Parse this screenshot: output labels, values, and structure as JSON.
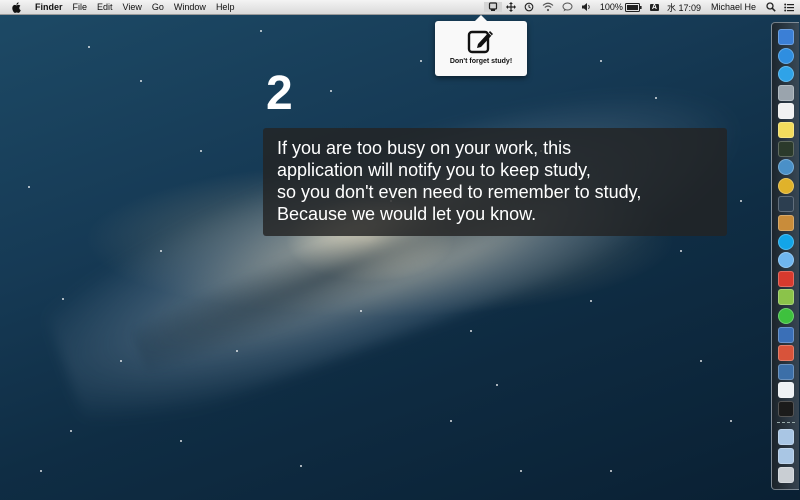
{
  "menubar": {
    "app_name": "Finder",
    "menus": [
      "File",
      "Edit",
      "View",
      "Go",
      "Window",
      "Help"
    ],
    "battery": "100%",
    "input_source": "A",
    "clock": "水 17:09",
    "user_name": "Michael He"
  },
  "popover": {
    "caption": "Don't forget study!"
  },
  "overlay": {
    "step_number": "2",
    "lines": [
      "If you are too busy on your work, this",
      "application will notify you to keep study,",
      "so you don't even need to remember to study,",
      "Because we would let you know."
    ]
  },
  "dock": {
    "items": [
      {
        "icon": "finder-icon",
        "color": "#3b7fd6"
      },
      {
        "icon": "app-store-icon",
        "color": "#2f8ee0"
      },
      {
        "icon": "itunes-icon",
        "color": "#2fa3e8"
      },
      {
        "icon": "photo-icon",
        "color": "#9aa4ad"
      },
      {
        "icon": "textedit-icon",
        "color": "#f1f1f1"
      },
      {
        "icon": "stickies-icon",
        "color": "#f2dc5d"
      },
      {
        "icon": "activity-monitor-icon",
        "color": "#2b3a2b"
      },
      {
        "icon": "network-icon",
        "color": "#4a90c8"
      },
      {
        "icon": "chrome-icon",
        "color": "#e0b22a"
      },
      {
        "icon": "facetime-icon",
        "color": "#2c3e50"
      },
      {
        "icon": "iphoto-icon",
        "color": "#c98c3a"
      },
      {
        "icon": "skype-icon",
        "color": "#12a5e8"
      },
      {
        "icon": "messages-icon",
        "color": "#6fb6ef"
      },
      {
        "icon": "qq-icon",
        "color": "#d83a2e"
      },
      {
        "icon": "android-icon",
        "color": "#8bc34a"
      },
      {
        "icon": "line-icon",
        "color": "#3ec13e"
      },
      {
        "icon": "xcode-icon",
        "color": "#3a6fb7"
      },
      {
        "icon": "maps-icon",
        "color": "#d8533a"
      },
      {
        "icon": "virtualbox-icon",
        "color": "#3c6fa8"
      },
      {
        "icon": "word-icon",
        "color": "#eef1f4"
      },
      {
        "icon": "terminal-icon",
        "color": "#1b1b1b"
      }
    ],
    "folders": [
      {
        "icon": "folder-icon",
        "color": "#a9c6e4"
      },
      {
        "icon": "downloads-folder-icon",
        "color": "#a9c6e4"
      },
      {
        "icon": "trash-icon",
        "color": "#c9ced3"
      }
    ]
  }
}
